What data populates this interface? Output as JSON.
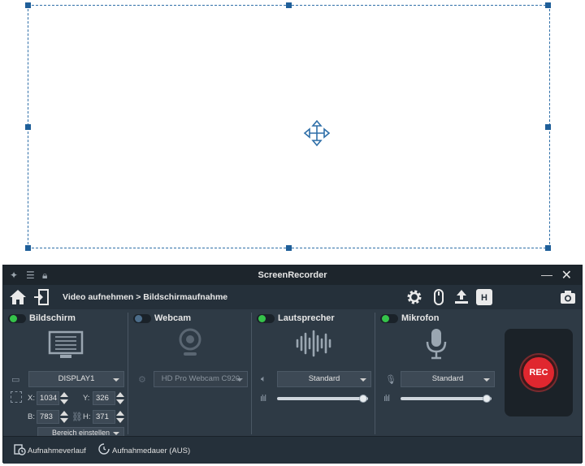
{
  "window": {
    "title": "ScreenRecorder"
  },
  "toolbar": {
    "breadcrumb": "Video aufnehmen > Bildschirmaufnahme",
    "hotkey_label": "H"
  },
  "screen": {
    "title": "Bildschirm",
    "enabled": true,
    "display": "DISPLAY1",
    "x_label": "X:",
    "x_value": "1034",
    "y_label": "Y:",
    "y_value": "326",
    "w_label": "B:",
    "w_value": "783",
    "h_label": "H:",
    "h_value": "371",
    "area_button": "Bereich einstellen"
  },
  "webcam": {
    "title": "Webcam",
    "enabled": false,
    "device": "HD Pro Webcam C920"
  },
  "speaker": {
    "title": "Lautsprecher",
    "enabled": true,
    "device": "Standard",
    "volume": 0.95
  },
  "microphone": {
    "title": "Mikrofon",
    "enabled": true,
    "device": "Standard",
    "volume": 0.95
  },
  "record": {
    "label": "REC",
    "color": "#e0272f"
  },
  "status": {
    "history": "Aufnahmeverlauf",
    "duration": "Aufnahmedauer (AUS)"
  },
  "colors": {
    "accent_on": "#35c34a",
    "panel_bg": "#2e3a45",
    "region_border": "#2f6fa8"
  },
  "icons": [
    "move-icon",
    "home-icon",
    "exit-icon",
    "gear-icon",
    "mouse-icon",
    "upload-icon",
    "camera-icon",
    "monitor-icon",
    "webcam-icon",
    "speaker-wave-icon",
    "microphone-icon"
  ]
}
